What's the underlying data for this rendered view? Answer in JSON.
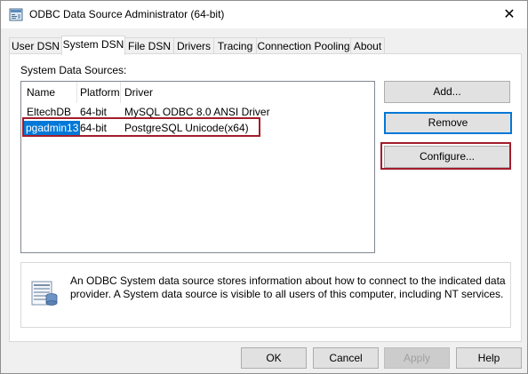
{
  "window": {
    "title": "ODBC Data Source Administrator (64-bit)",
    "close_glyph": "✕"
  },
  "tabs": [
    {
      "label": "User DSN",
      "active": false
    },
    {
      "label": "System DSN",
      "active": true
    },
    {
      "label": "File DSN",
      "active": false
    },
    {
      "label": "Drivers",
      "active": false
    },
    {
      "label": "Tracing",
      "active": false
    },
    {
      "label": "Connection Pooling",
      "active": false
    },
    {
      "label": "About",
      "active": false
    }
  ],
  "system_dsn": {
    "group_label": "System Data Sources:",
    "columns": [
      "Name",
      "Platform",
      "Driver"
    ],
    "rows": [
      {
        "name": "EltechDB",
        "platform": "64-bit",
        "driver": "MySQL ODBC 8.0 ANSI Driver",
        "selected": false
      },
      {
        "name": "pgadmin13",
        "platform": "64-bit",
        "driver": "PostgreSQL Unicode(x64)",
        "selected": true
      }
    ],
    "buttons": {
      "add": "Add...",
      "remove": "Remove",
      "configure": "Configure..."
    },
    "info_text": "An ODBC System data source stores information about how to connect to the indicated data provider. A System data source is visible to all users of this computer, including NT services."
  },
  "footer": {
    "ok": "OK",
    "cancel": "Cancel",
    "apply": "Apply",
    "help": "Help"
  },
  "colors": {
    "selection": "#0078d7",
    "annotation_red": "#a31d2b"
  },
  "icons": {
    "app": "odbc-admin-icon",
    "info": "database-info-icon"
  }
}
